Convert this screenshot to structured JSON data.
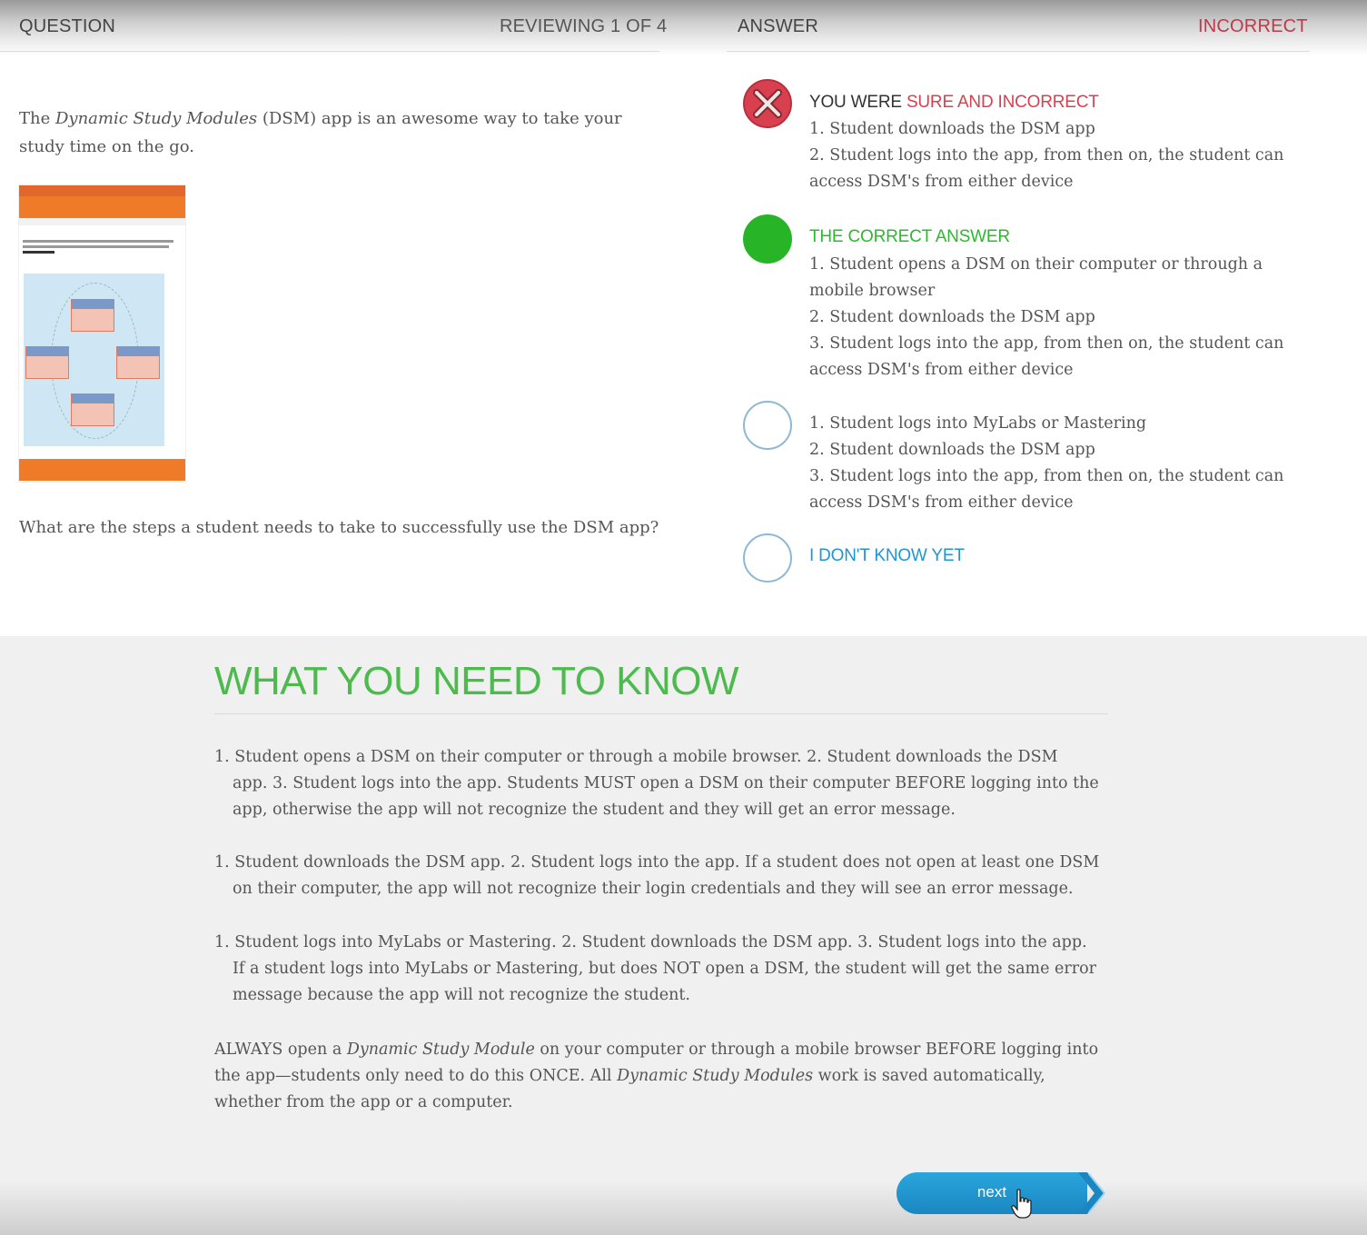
{
  "header": {
    "question_label": "QUESTION",
    "reviewing": "REVIEWING 1 OF 4",
    "answer_label": "ANSWER",
    "result": "INCORRECT"
  },
  "question": {
    "intro_pre": "The ",
    "intro_italic": "Dynamic Study Modules",
    "intro_post": " (DSM) app is an awesome way to take your study time on the go.",
    "prompt": "What are the steps a student needs to take to successfully use the DSM app?"
  },
  "answers": {
    "selected": {
      "heading_prefix": "YOU WERE ",
      "heading_status": "SURE AND INCORRECT",
      "lines": [
        "1. Student downloads the DSM app",
        "2. Student logs into the app, from then on, the student can access DSM's from either device"
      ]
    },
    "correct": {
      "heading": "THE CORRECT ANSWER",
      "lines": [
        "1. Student opens a DSM on their computer or through a mobile browser",
        "2. Student downloads the DSM app",
        "3. Student logs into the app, from then on, the student can access DSM's from either device"
      ]
    },
    "other": {
      "lines": [
        "1. Student logs into MyLabs or Mastering",
        "2. Student downloads the DSM app",
        "3. Student logs into the app, from then on, the student can access DSM's from either device"
      ]
    },
    "dont_know": "I DON'T KNOW YET"
  },
  "info": {
    "title": "WHAT YOU NEED TO KNOW",
    "p1_first": "1. Student opens a DSM on their computer or through a mobile browser. 2. Student downloads the DSM",
    "p1_rest": "app. 3. Student logs into the app. Students MUST open a DSM on their computer BEFORE logging into the app, otherwise the app will not recognize the student and they will get an error message.",
    "p2_first": "1. Student downloads the DSM app. 2. Student logs into the app. If a student does not open at least one DSM",
    "p2_rest": "on their computer, the app will not recognize their login credentials and they will see an error message.",
    "p3_first": "1. Student logs into MyLabs or Mastering. 2. Student downloads the DSM app. 3. Student logs into the app.",
    "p3_rest": "If a student logs into MyLabs or Mastering, but does NOT open a DSM, the student will get the same error message because the app will not recognize the student.",
    "p4_a": "ALWAYS open a ",
    "p4_b": "Dynamic Study Module",
    "p4_c": " on your computer or through a mobile browser BEFORE logging into the app—students only need to do this ONCE. All ",
    "p4_d": "Dynamic Study Modules",
    "p4_e": " work is saved automatically, whether from the app or a computer."
  },
  "next_label": "next",
  "colors": {
    "incorrect": "#c0394b",
    "correct": "#2db92d",
    "accent_blue": "#1e96cf",
    "title_green": "#4cba4c"
  },
  "icons": {
    "selected": "x-circle-icon",
    "correct": "check-circle-icon",
    "empty": "empty-circle-icon",
    "cursor": "hand-pointer-icon"
  }
}
